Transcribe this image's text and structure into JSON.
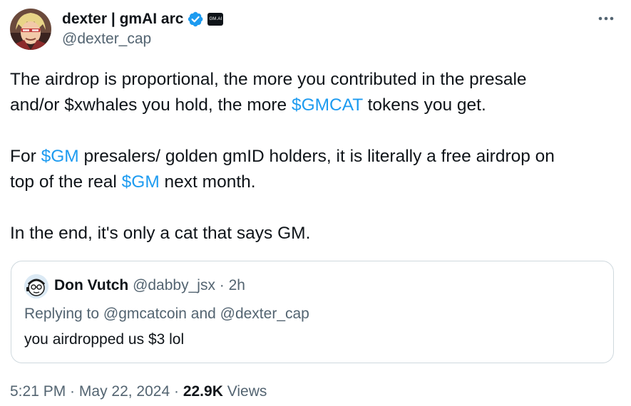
{
  "author": {
    "display_name": "dexter | gmAI arc",
    "handle": "@dexter_cap",
    "affiliation_badge_text": "GM.AI",
    "verified_icon": "verified-badge-icon",
    "avatar_icon": "avatar-anime-character",
    "colors": {
      "verified": "#1d9bf0"
    }
  },
  "tweet": {
    "more_icon": "more-options-icon",
    "line1": "The airdrop is proportional, the more you contributed in the presale",
    "line2_pre": "and/or $xwhales you hold, the more ",
    "line2_tag": "$GMCAT",
    "line2_post": " tokens you get.",
    "line3_pre": "For ",
    "line3_tag": "$GM",
    "line3_post": " presalers/ golden gmID holders, it is literally a free airdrop on",
    "line4_pre": "top of the real ",
    "line4_tag": "$GM",
    "line4_post": " next month.",
    "line5": "In the end, it's only a cat that says GM."
  },
  "quote": {
    "display_name": "Don Vutch",
    "handle": "@dabby_jsx",
    "separator": " · ",
    "time": "2h",
    "replying_to": "Replying to @gmcatcoin and @dexter_cap",
    "text": "you airdropped us $3 lol"
  },
  "meta": {
    "time": "5:21 PM",
    "separator": " · ",
    "date": "May 22, 2024",
    "views_count": "22.9K",
    "views_label": "Views"
  },
  "colors": {
    "text": "#0f1419",
    "secondary": "#536471",
    "link": "#1d9bf0",
    "border": "#cfd9de"
  }
}
